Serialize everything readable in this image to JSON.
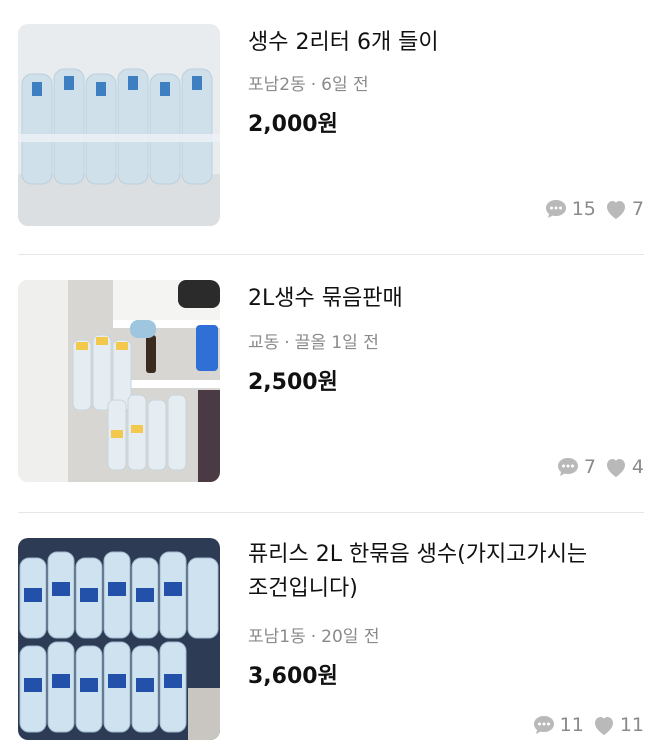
{
  "listings": [
    {
      "title": "생수 2리터 6개 들이",
      "location": "포남2동",
      "time": "6일 전",
      "price": "2,000원",
      "chats": "15",
      "likes": "7",
      "image": "bottled-water-photo"
    },
    {
      "title": "2L생수 묶음판매",
      "location": "교동",
      "time": "끌올 1일 전",
      "price": "2,500원",
      "chats": "7",
      "likes": "4",
      "image": "bottled-water-photo"
    },
    {
      "title_line1": "퓨리스 2L 한묶음 생수(가지고가시는",
      "title_line2": "조건입니다)",
      "location": "포남1동",
      "time": "20일 전",
      "price": "3,600원",
      "chats": "11",
      "likes": "11",
      "image": "bottled-water-photo"
    }
  ],
  "separator": "·",
  "icons": {
    "chat": "chat-bubble-icon",
    "like": "heart-icon"
  },
  "colors": {
    "meta": "#8a8a8a",
    "icon": "#b9b9b9",
    "divider": "#e6e6e6"
  }
}
